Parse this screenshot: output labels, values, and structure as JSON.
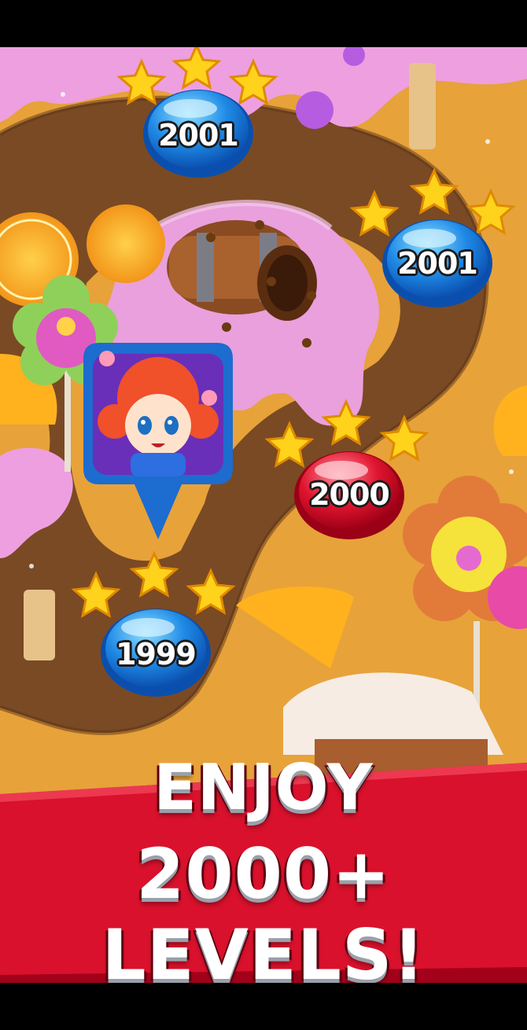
{
  "levels": [
    {
      "id": "level-2001-top",
      "label": "2001",
      "color": "blue",
      "stars": 3
    },
    {
      "id": "level-2001-right",
      "label": "2001",
      "color": "blue",
      "stars": 3
    },
    {
      "id": "level-2000",
      "label": "2000",
      "color": "red",
      "stars": 3
    },
    {
      "id": "level-1999",
      "label": "1999",
      "color": "blue",
      "stars": 3
    }
  ],
  "banner": {
    "line1": "ENJOY",
    "line2": "2000+ LEVELS!"
  },
  "colors": {
    "blue_node": "#1e7fe0",
    "red_node": "#e0142e",
    "banner_red": "#d9112c",
    "path_brown": "#7a4a24",
    "frosting_pink": "#e9a0dc",
    "star_gold": "#ffd21c"
  },
  "icons": [
    "star-icon",
    "barrel-icon",
    "flower-lollipop-icon",
    "player-avatar-icon"
  ]
}
